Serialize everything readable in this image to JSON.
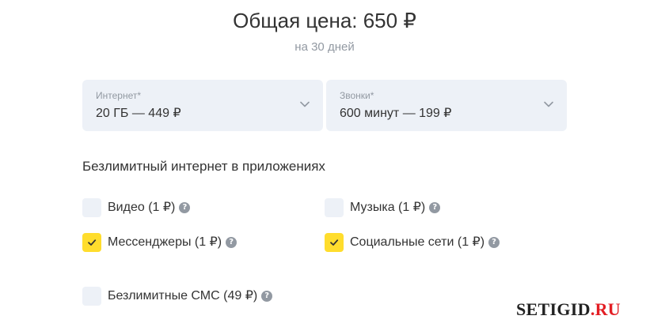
{
  "summary": {
    "total_price": "Общая цена: 650 ₽",
    "period": "на 30 дней"
  },
  "selects": {
    "internet": {
      "label": "Интернет*",
      "value": "20 ГБ — 449 ₽"
    },
    "calls": {
      "label": "Звонки*",
      "value": "600 минут — 199 ₽"
    }
  },
  "unlimited": {
    "title": "Безлимитный интернет в приложениях",
    "options": [
      {
        "label": "Видео (1 ₽)",
        "checked": false
      },
      {
        "label": "Музыка (1 ₽)",
        "checked": false
      },
      {
        "label": "Мессенджеры (1 ₽)",
        "checked": true
      },
      {
        "label": "Социальные сети (1 ₽)",
        "checked": true
      }
    ]
  },
  "sms": {
    "label": "Безлимитные СМС (49 ₽)",
    "checked": false
  },
  "icons": {
    "help": "question-circle-icon",
    "chevron": "chevron-down-icon",
    "check": "checkmark-icon"
  },
  "colors": {
    "accent": "#ffdd2d",
    "field_background": "#edf1f7",
    "muted_text": "#9299a2",
    "watermark_accent": "#e31e24"
  },
  "watermark": {
    "main": "SETIGID",
    "suffix": ".RU"
  }
}
